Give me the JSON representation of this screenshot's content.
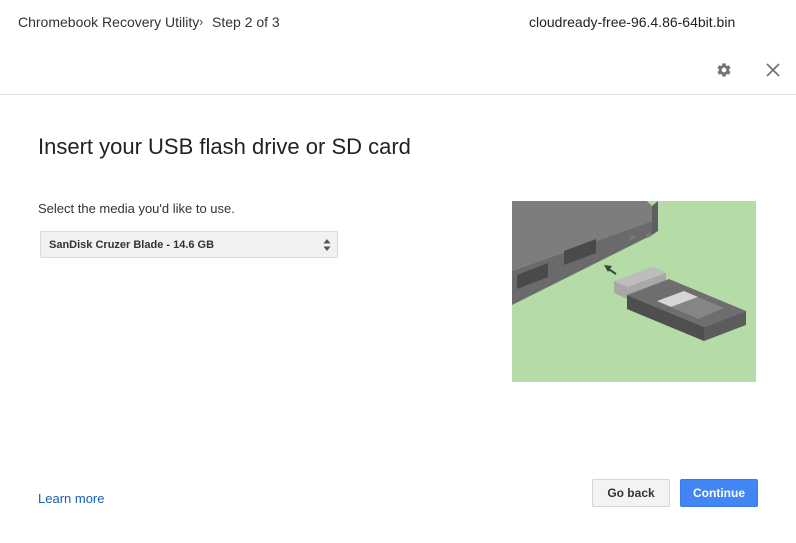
{
  "header": {
    "app_name": "Chromebook Recovery Utility",
    "separator": "›",
    "step": "Step 2 of 3",
    "filename": "cloudready-free-96.4.86-64bit.bin",
    "icons": {
      "settings": "gear-icon",
      "close": "close-icon"
    }
  },
  "main": {
    "title": "Insert your USB flash drive or SD card",
    "prompt": "Select the media you'd like to use.",
    "media_select": {
      "selected": "SanDisk Cruzer Blade - 14.6 GB"
    },
    "illustration": "usb-drive-inserting-into-laptop"
  },
  "footer": {
    "learn_more": "Learn more",
    "go_back": "Go back",
    "continue": "Continue"
  },
  "colors": {
    "accent": "#4285f4",
    "link": "#1a5fb4",
    "illustration_bg": "#b5dca6"
  }
}
